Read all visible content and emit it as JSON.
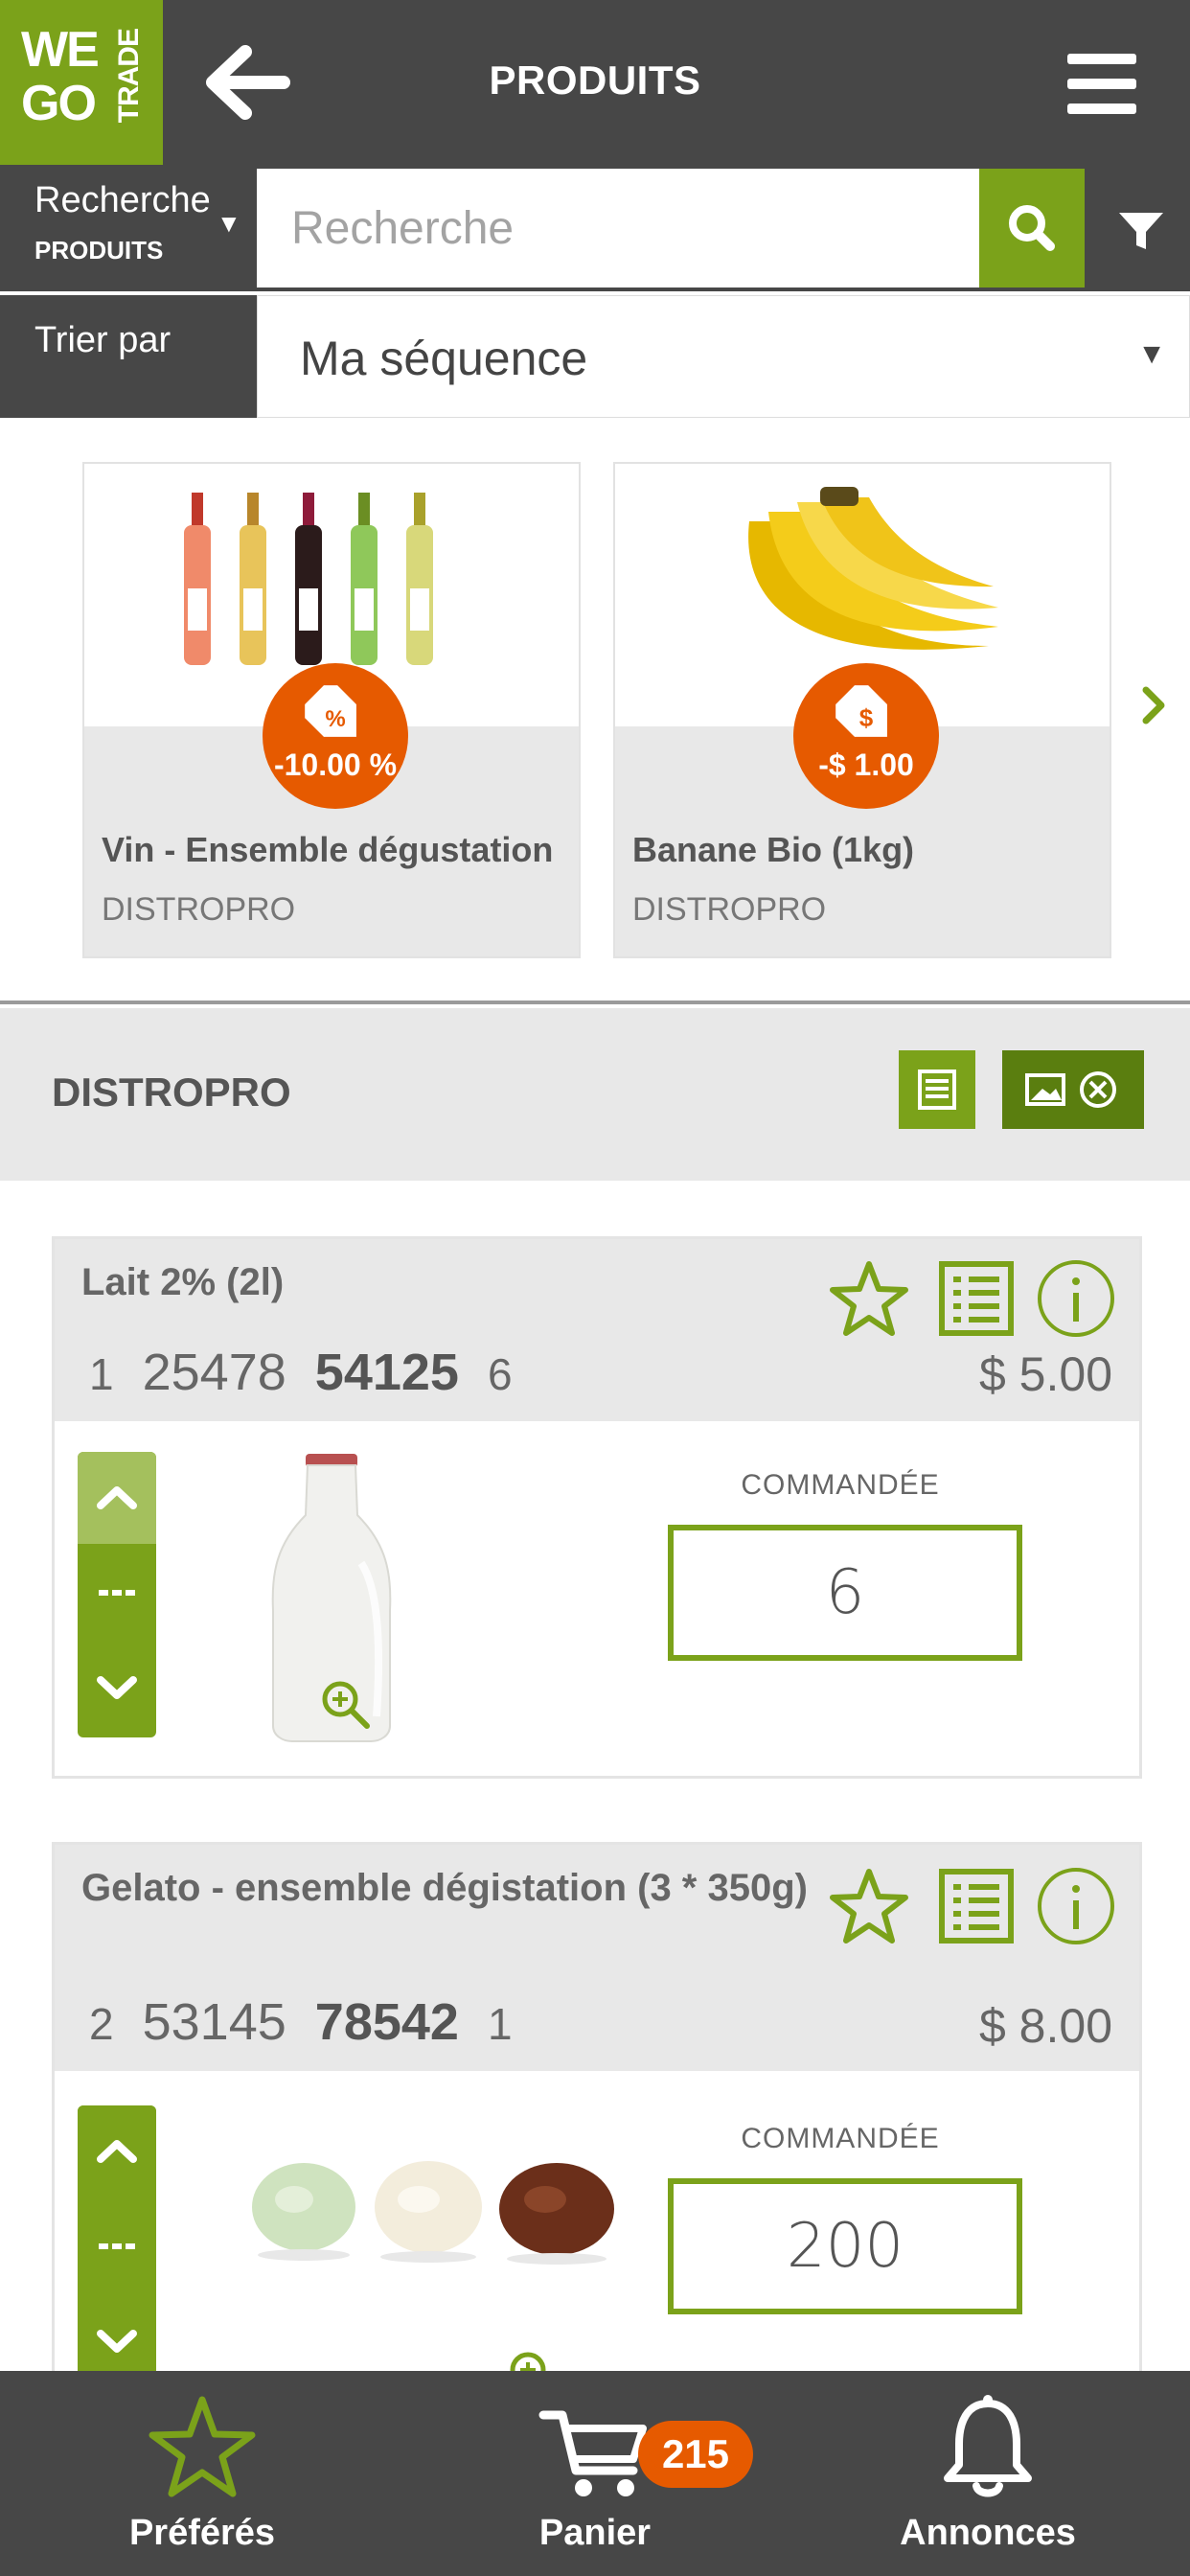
{
  "app": {
    "logo_we": "WE",
    "logo_go": "GO",
    "logo_trade": "TRADE",
    "title": "PRODUITS"
  },
  "search": {
    "type_label": "Recherche",
    "type_value": "PRODUITS",
    "placeholder": "Recherche",
    "value": ""
  },
  "sort": {
    "label": "Trier par",
    "value": "Ma séquence"
  },
  "promotions": [
    {
      "name": "Vin - Ensemble dégustation",
      "vendor": "DISTROPRO",
      "discount": "-10.00 %",
      "badge_icon": "percent-tag-icon"
    },
    {
      "name": "Banane Bio (1kg)",
      "vendor": "DISTROPRO",
      "discount": "-$ 1.00",
      "badge_icon": "dollar-tag-icon"
    }
  ],
  "vendor": {
    "name": "DISTROPRO"
  },
  "products": [
    {
      "name": "Lait 2% (2l)",
      "code_1": "1",
      "code_2": "25478",
      "code_3": "54125",
      "code_4": "6",
      "price": "$ 5.00",
      "ordered_label": "COMMANDÉE",
      "quantity": "6"
    },
    {
      "name": "Gelato - ensemble dégistation (3 * 350g)",
      "code_1": "2",
      "code_2": "53145",
      "code_3": "78542",
      "code_4": "1",
      "price": "$ 8.00",
      "ordered_label": "COMMANDÉE",
      "quantity": "200"
    }
  ],
  "bottom_nav": {
    "favorites": "Préférés",
    "cart": "Panier",
    "cart_count": "215",
    "announcements": "Annonces"
  },
  "colors": {
    "accent_green": "#7ba21a",
    "dark_bar": "#474747",
    "badge_orange": "#e65a00",
    "panel_gray": "#e8e8e8"
  }
}
